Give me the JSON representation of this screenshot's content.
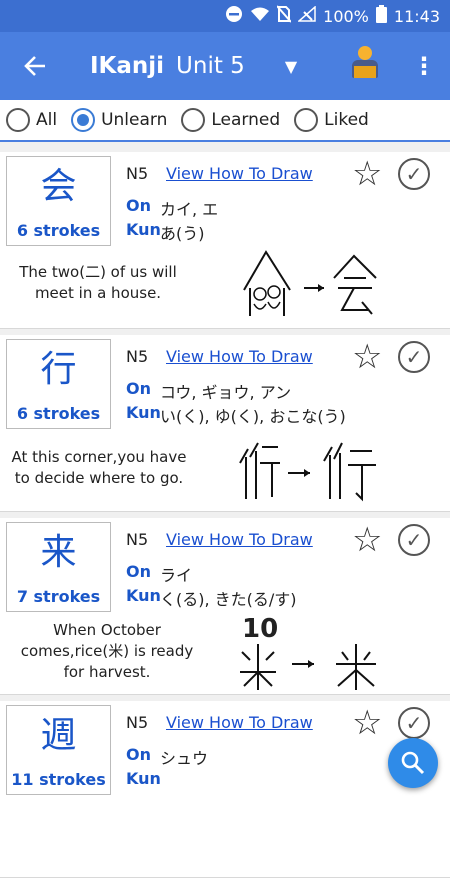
{
  "status_bar": {
    "battery": "100%",
    "time": "11:43"
  },
  "app_bar": {
    "title": "IKanji",
    "unit": "Unit 5"
  },
  "filters": [
    {
      "label": "All",
      "checked": false
    },
    {
      "label": "Unlearn",
      "checked": true
    },
    {
      "label": "Learned",
      "checked": false
    },
    {
      "label": "Liked",
      "checked": false
    }
  ],
  "cards": [
    {
      "kanji": "会",
      "strokes": "6 strokes",
      "level": "N5",
      "howto": "View How To Draw",
      "on_label": "On",
      "on": "カイ, エ",
      "kun_label": "Kun",
      "kun": "あ(う)",
      "mnemonic": "The two(二) of us will meet in a house."
    },
    {
      "kanji": "行",
      "strokes": "6 strokes",
      "level": "N5",
      "howto": "View How To Draw",
      "on_label": "On",
      "on": "コウ, ギョウ, アン",
      "kun_label": "Kun",
      "kun": "い(く), ゆ(く), おこな(う)",
      "mnemonic": "At this corner,you have to decide where to go."
    },
    {
      "kanji": "来",
      "strokes": "7 strokes",
      "level": "N5",
      "howto": "View How To Draw",
      "on_label": "On",
      "on": "ライ",
      "kun_label": "Kun",
      "kun": "く(る), きた(る/す)",
      "mnemonic": "When October comes,rice(米) is ready for harvest.",
      "illus_text": "10"
    },
    {
      "kanji": "週",
      "strokes": "11 strokes",
      "level": "N5",
      "howto": "View How To Draw",
      "on_label": "On",
      "on": "シュウ",
      "kun_label": "Kun",
      "kun": ""
    }
  ],
  "colors": {
    "accent": "#4a7fe0",
    "status": "#3c6fd0",
    "kanji": "#1a56c8",
    "fab": "#2f8be8"
  }
}
